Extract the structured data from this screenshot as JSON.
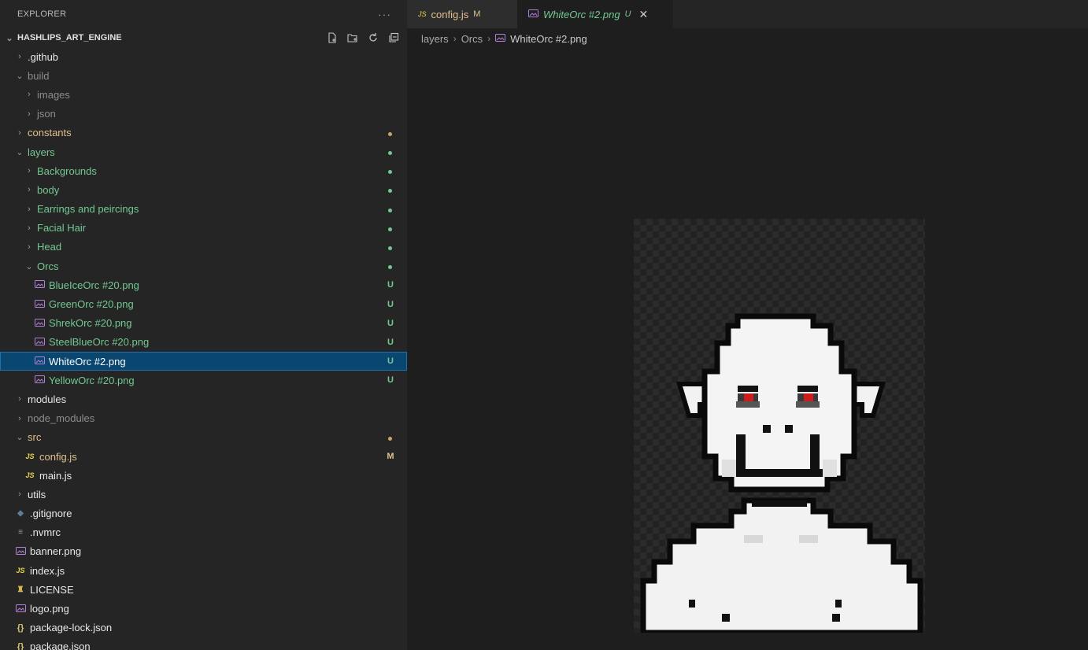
{
  "explorer": {
    "title": "EXPLORER",
    "more": "···",
    "project": "HASHLIPS_ART_ENGINE"
  },
  "tree": [
    {
      "label": ".github",
      "depth": 0,
      "kind": "folder",
      "open": false,
      "color": "white"
    },
    {
      "label": "build",
      "depth": 0,
      "kind": "folder",
      "open": true,
      "color": "gray"
    },
    {
      "label": "images",
      "depth": 1,
      "kind": "folder",
      "open": false,
      "color": "gray"
    },
    {
      "label": "json",
      "depth": 1,
      "kind": "folder",
      "open": false,
      "color": "gray"
    },
    {
      "label": "constants",
      "depth": 0,
      "kind": "folder",
      "open": false,
      "color": "gold",
      "dot": "gold"
    },
    {
      "label": "layers",
      "depth": 0,
      "kind": "folder",
      "open": true,
      "color": "green",
      "dot": "green"
    },
    {
      "label": "Backgrounds",
      "depth": 1,
      "kind": "folder",
      "open": false,
      "color": "green",
      "dot": "green"
    },
    {
      "label": "body",
      "depth": 1,
      "kind": "folder",
      "open": false,
      "color": "green",
      "dot": "green"
    },
    {
      "label": "Earrings and peircings",
      "depth": 1,
      "kind": "folder",
      "open": false,
      "color": "green",
      "dot": "green"
    },
    {
      "label": "Facial Hair",
      "depth": 1,
      "kind": "folder",
      "open": false,
      "color": "green",
      "dot": "green"
    },
    {
      "label": "Head",
      "depth": 1,
      "kind": "folder",
      "open": false,
      "color": "green",
      "dot": "green"
    },
    {
      "label": "Orcs",
      "depth": 1,
      "kind": "folder",
      "open": true,
      "color": "green",
      "dot": "green"
    },
    {
      "label": "BlueIceOrc #20.png",
      "depth": 2,
      "kind": "image",
      "color": "green",
      "badge": "U"
    },
    {
      "label": "GreenOrc #20.png",
      "depth": 2,
      "kind": "image",
      "color": "green",
      "badge": "U"
    },
    {
      "label": "ShrekOrc #20.png",
      "depth": 2,
      "kind": "image",
      "color": "green",
      "badge": "U"
    },
    {
      "label": "SteelBlueOrc #20.png",
      "depth": 2,
      "kind": "image",
      "color": "green",
      "badge": "U"
    },
    {
      "label": "WhiteOrc #2.png",
      "depth": 2,
      "kind": "image",
      "color": "sel",
      "badge": "U",
      "selected": true
    },
    {
      "label": "YellowOrc #20.png",
      "depth": 2,
      "kind": "image",
      "color": "green",
      "badge": "U"
    },
    {
      "label": "modules",
      "depth": 0,
      "kind": "folder",
      "open": false,
      "color": "white"
    },
    {
      "label": "node_modules",
      "depth": 0,
      "kind": "folder",
      "open": false,
      "color": "gray"
    },
    {
      "label": "src",
      "depth": 0,
      "kind": "folder",
      "open": true,
      "color": "gold",
      "dot": "gold"
    },
    {
      "label": "config.js",
      "depth": 1,
      "kind": "js",
      "color": "gold",
      "badge": "M"
    },
    {
      "label": "main.js",
      "depth": 1,
      "kind": "js",
      "color": "white"
    },
    {
      "label": "utils",
      "depth": 0,
      "kind": "folder",
      "open": false,
      "color": "white"
    },
    {
      "label": ".gitignore",
      "depth": 0,
      "kind": "git",
      "color": "white"
    },
    {
      "label": ".nvmrc",
      "depth": 0,
      "kind": "text",
      "color": "white"
    },
    {
      "label": "banner.png",
      "depth": 0,
      "kind": "image",
      "color": "white"
    },
    {
      "label": "index.js",
      "depth": 0,
      "kind": "js",
      "color": "white"
    },
    {
      "label": "LICENSE",
      "depth": 0,
      "kind": "license",
      "color": "white"
    },
    {
      "label": "logo.png",
      "depth": 0,
      "kind": "image",
      "color": "white"
    },
    {
      "label": "package-lock.json",
      "depth": 0,
      "kind": "json",
      "color": "white"
    },
    {
      "label": "package.json",
      "depth": 0,
      "kind": "json",
      "color": "white"
    }
  ],
  "tabs": [
    {
      "icon": "JS",
      "name": "config.js",
      "flag": "M"
    },
    {
      "name": "WhiteOrc #2.png",
      "flag": "U",
      "close": "✕"
    }
  ],
  "breadcrumb": {
    "parts": [
      "layers",
      "Orcs"
    ],
    "current": "WhiteOrc #2.png",
    "sep": "›"
  },
  "colors": {
    "selection": "#094771",
    "git_untracked": "#73c991",
    "git_modified": "#e2c08d"
  }
}
